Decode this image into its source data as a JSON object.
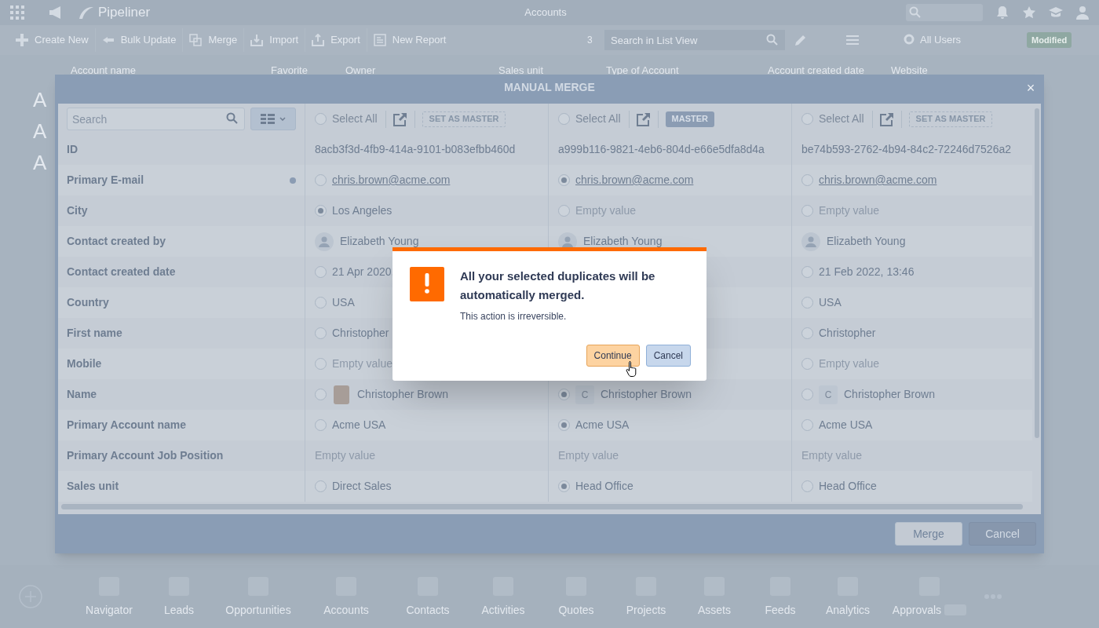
{
  "top_bar": {
    "logo": "Pipeliner",
    "title": "Accounts"
  },
  "toolbar": {
    "actions": [
      {
        "kind": "create",
        "label": "Create New"
      },
      {
        "kind": "bulk",
        "label": "Bulk Update"
      },
      {
        "kind": "merge",
        "label": "Merge"
      },
      {
        "kind": "import",
        "label": "Import"
      },
      {
        "kind": "export",
        "label": "Export"
      },
      {
        "kind": "report",
        "label": "New Report"
      }
    ],
    "count": "3",
    "search": {
      "placeholder": "Search in List View"
    },
    "filter": "All Users",
    "badge": "Modified"
  },
  "list": {
    "columns": [
      "Account name",
      "Favorite",
      "Owner",
      "Sales unit",
      "Type of Account",
      "Account created date",
      "Website"
    ],
    "row_initials": [
      "A",
      "A",
      "A"
    ]
  },
  "manual_merge": {
    "title": "MANUAL MERGE",
    "close": "×",
    "search": {
      "placeholder": "Search"
    },
    "records": [
      {
        "select_all": "Select All",
        "selected": false,
        "master": false,
        "badge": "SET AS MASTER"
      },
      {
        "select_all": "Select All",
        "selected": false,
        "master": true,
        "badge": "MASTER"
      },
      {
        "select_all": "Select All",
        "selected": false,
        "master": false,
        "badge": "SET AS MASTER"
      }
    ],
    "rows": [
      {
        "label": "ID",
        "dot": false,
        "cells": [
          {
            "kind": "text",
            "text": "8acb3f3d-4fb9-414a-9101-b083efbb460d",
            "empty": false
          },
          {
            "kind": "text",
            "text": "a999b116-9821-4eb6-804d-e66e5dfa8d4a",
            "empty": false
          },
          {
            "kind": "text",
            "text": "be74b593-2762-4b94-84c2-72246d7526a2",
            "empty": false
          }
        ]
      },
      {
        "label": "Primary E-mail",
        "dot": true,
        "cells": [
          {
            "kind": "link",
            "text": "chris.brown@acme.com",
            "selected": false
          },
          {
            "kind": "link",
            "text": "chris.brown@acme.com",
            "selected": true
          },
          {
            "kind": "link",
            "text": "chris.brown@acme.com",
            "selected": false
          }
        ]
      },
      {
        "label": "City",
        "dot": false,
        "cells": [
          {
            "kind": "radio",
            "text": "Los Angeles",
            "selected": true,
            "empty": false
          },
          {
            "kind": "radio",
            "text": "Empty value",
            "selected": false,
            "empty": true
          },
          {
            "kind": "radio",
            "text": "Empty value",
            "selected": false,
            "empty": true
          }
        ]
      },
      {
        "label": "Contact created by",
        "dot": false,
        "cells": [
          {
            "kind": "user",
            "text": "Elizabeth Young"
          },
          {
            "kind": "user",
            "text": "Elizabeth Young"
          },
          {
            "kind": "user",
            "text": "Elizabeth Young"
          }
        ]
      },
      {
        "label": "Contact created date",
        "dot": false,
        "cells": [
          {
            "kind": "radio",
            "text": "21 Apr 2020,",
            "selected": false,
            "empty": false
          },
          null,
          {
            "kind": "radio",
            "text": "21 Feb 2022, 13:46",
            "selected": false,
            "empty": false
          }
        ]
      },
      {
        "label": "Country",
        "dot": false,
        "cells": [
          {
            "kind": "radio",
            "text": "USA",
            "selected": false,
            "empty": false
          },
          null,
          {
            "kind": "radio",
            "text": "USA",
            "selected": false,
            "empty": false
          }
        ]
      },
      {
        "label": "First name",
        "dot": false,
        "cells": [
          {
            "kind": "radio",
            "text": "Christopher",
            "selected": false,
            "empty": false
          },
          null,
          {
            "kind": "radio",
            "text": "Christopher",
            "selected": false,
            "empty": false
          }
        ]
      },
      {
        "label": "Mobile",
        "dot": false,
        "cells": [
          {
            "kind": "radio",
            "text": "Empty value",
            "selected": false,
            "empty": true
          },
          null,
          {
            "kind": "radio",
            "text": "Empty value",
            "selected": false,
            "empty": true
          }
        ]
      },
      {
        "label": "Name",
        "dot": false,
        "cells": [
          {
            "kind": "contact",
            "text": "Christopher Brown",
            "selected": false
          },
          {
            "kind": "contact",
            "initial": "C",
            "text": "Christopher Brown",
            "selected": true
          },
          {
            "kind": "contact",
            "initial": "C",
            "text": "Christopher Brown",
            "selected": false
          }
        ]
      },
      {
        "label": "Primary Account name",
        "dot": false,
        "cells": [
          {
            "kind": "radio",
            "text": "Acme USA",
            "selected": false,
            "empty": false
          },
          {
            "kind": "radio",
            "text": "Acme USA",
            "selected": true,
            "empty": false
          },
          {
            "kind": "radio",
            "text": "Acme USA",
            "selected": false,
            "empty": false
          }
        ]
      },
      {
        "label": "Primary Account Job Position",
        "dot": false,
        "cells": [
          {
            "kind": "text",
            "text": "Empty value",
            "empty": true
          },
          {
            "kind": "text",
            "text": "Empty value",
            "empty": true
          },
          {
            "kind": "text",
            "text": "Empty value",
            "empty": true
          }
        ]
      },
      {
        "label": "Sales unit",
        "dot": false,
        "cells": [
          {
            "kind": "radio",
            "text": "Direct Sales",
            "selected": false,
            "empty": false
          },
          {
            "kind": "radio",
            "text": "Head Office",
            "selected": true,
            "empty": false
          },
          {
            "kind": "radio",
            "text": "Head Office",
            "selected": false,
            "empty": false
          }
        ]
      }
    ],
    "buttons": [
      "Merge",
      "Cancel"
    ]
  },
  "confirm": {
    "title": "All your selected duplicates will be automatically merged.",
    "message": "This action is irreversible.",
    "buttons": [
      {
        "label": "Continue",
        "kind": "primary"
      },
      {
        "label": "Cancel",
        "kind": "secondary"
      }
    ]
  },
  "bottom_nav": [
    {
      "kind": "navigator",
      "label": "Navigator"
    },
    {
      "kind": "leads",
      "label": "Leads"
    },
    {
      "kind": "opportunities",
      "label": "Opportunities"
    },
    {
      "kind": "accounts",
      "label": "Accounts"
    },
    {
      "kind": "contacts",
      "label": "Contacts"
    },
    {
      "kind": "activities",
      "label": "Activities"
    },
    {
      "kind": "quotes",
      "label": "Quotes"
    },
    {
      "kind": "projects",
      "label": "Projects"
    },
    {
      "kind": "assets",
      "label": "Assets"
    },
    {
      "kind": "feeds",
      "label": "Feeds"
    },
    {
      "kind": "analytics",
      "label": "Analytics"
    },
    {
      "kind": "approvals",
      "label": "Approvals"
    }
  ]
}
